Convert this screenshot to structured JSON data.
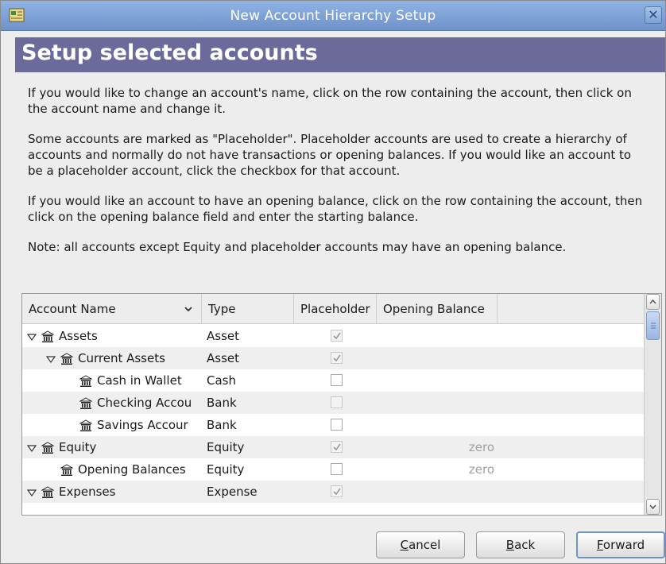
{
  "window": {
    "title": "New Account Hierarchy Setup",
    "close_glyph": "✕",
    "icon": "gnucash-app-icon"
  },
  "page": {
    "heading": "Setup selected accounts",
    "heading_band_color": "#6b6a9a"
  },
  "instructions": [
    "If you would like to change an account's name, click on the row containing the account, then click on the account name and change it.",
    "Some accounts are marked as \"Placeholder\". Placeholder accounts are used to create a hierarchy of accounts and normally do not have transactions or opening balances. If you would like an account to be a placeholder account, click the checkbox for that account.",
    "If you would like an account to have an opening balance, click on the row containing the account, then click on the opening balance field and enter the starting balance.",
    "Note: all accounts except Equity and placeholder accounts may have an opening balance."
  ],
  "tree": {
    "columns": {
      "name": "Account Name",
      "type": "Type",
      "placeholder": "Placeholder",
      "opening_balance": "Opening Balance"
    },
    "rows": [
      {
        "level": 0,
        "expander": true,
        "name": "Assets",
        "type": "Asset",
        "placeholder": true,
        "placeholder_dim": false,
        "opening_balance": ""
      },
      {
        "level": 1,
        "expander": true,
        "name": "Current Assets",
        "type": "Asset",
        "placeholder": true,
        "placeholder_dim": false,
        "opening_balance": ""
      },
      {
        "level": 2,
        "expander": false,
        "name": "Cash in Wallet",
        "type": "Cash",
        "placeholder": false,
        "placeholder_dim": false,
        "opening_balance": ""
      },
      {
        "level": 2,
        "expander": false,
        "name": "Checking Accou",
        "type": "Bank",
        "placeholder": false,
        "placeholder_dim": true,
        "opening_balance": ""
      },
      {
        "level": 2,
        "expander": false,
        "name": "Savings Accour",
        "type": "Bank",
        "placeholder": false,
        "placeholder_dim": false,
        "opening_balance": ""
      },
      {
        "level": 0,
        "expander": true,
        "name": "Equity",
        "type": "Equity",
        "placeholder": true,
        "placeholder_dim": false,
        "opening_balance": "zero"
      },
      {
        "level": 1,
        "expander": false,
        "name": "Opening Balances",
        "type": "Equity",
        "placeholder": false,
        "placeholder_dim": false,
        "opening_balance": "zero"
      },
      {
        "level": 0,
        "expander": true,
        "name": "Expenses",
        "type": "Expense",
        "placeholder": true,
        "placeholder_dim": false,
        "opening_balance": ""
      }
    ]
  },
  "buttons": {
    "cancel": {
      "mnemonic": "C",
      "rest": "ancel"
    },
    "back": {
      "mnemonic": "B",
      "rest": "ack"
    },
    "forward": {
      "mnemonic": "F",
      "rest": "orward"
    }
  }
}
